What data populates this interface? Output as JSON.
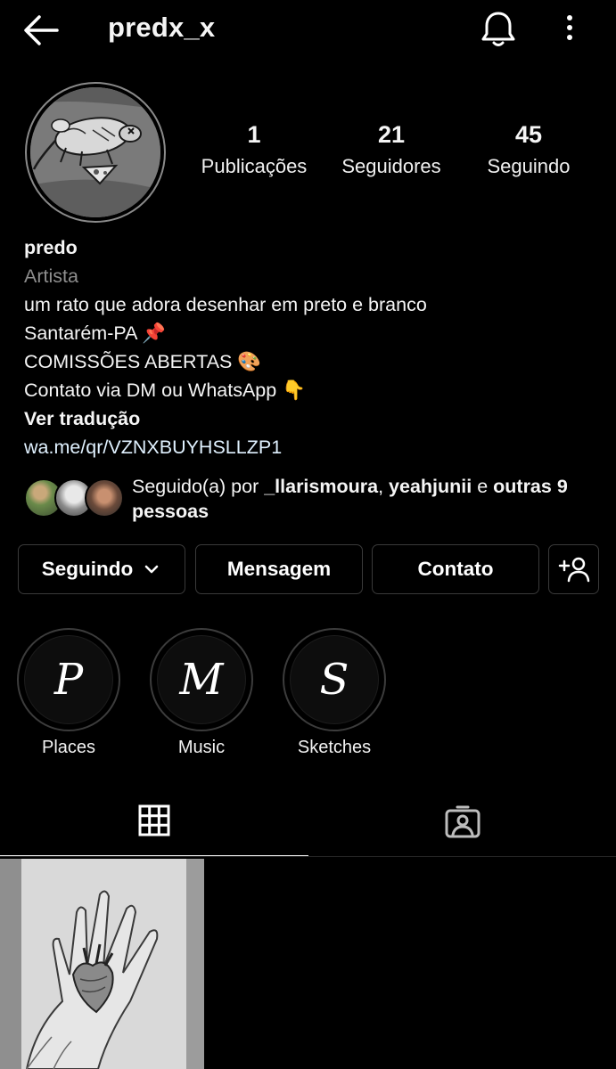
{
  "header": {
    "username": "predx_x",
    "back_icon": "arrow-left-icon",
    "notifications_icon": "bell-icon",
    "more_icon": "more-vertical-icon"
  },
  "profile": {
    "avatar_icon": "rat-drawing-avatar",
    "stats": [
      {
        "value": "1",
        "label": "Publicações"
      },
      {
        "value": "21",
        "label": "Seguidores"
      },
      {
        "value": "45",
        "label": "Seguindo"
      }
    ]
  },
  "bio": {
    "name": "predo",
    "category": "Artista",
    "lines": [
      "um rato que adora desenhar em preto e branco",
      "Santarém-PA 📌",
      "COMISSÕES ABERTAS 🎨",
      "Contato via DM ou WhatsApp 👇"
    ],
    "translate_label": "Ver tradução",
    "link": "wa.me/qr/VZNXBUYHSLLZP1"
  },
  "followed_by": {
    "prefix": "Seguido(a) por ",
    "user1": "_llarismoura",
    "separator": ", ",
    "user2": "yeahjunii",
    "connector": " e ",
    "others": "outras 9 pessoas"
  },
  "actions": {
    "following_label": "Seguindo",
    "message_label": "Mensagem",
    "contact_label": "Contato",
    "add_user_icon": "add-user-icon",
    "chevron_icon": "chevron-down-icon"
  },
  "highlights": [
    {
      "letter": "P",
      "label": "Places"
    },
    {
      "letter": "M",
      "label": "Music"
    },
    {
      "letter": "S",
      "label": "Sketches"
    }
  ],
  "tabs": {
    "grid_icon": "grid-icon",
    "tagged_icon": "tagged-person-icon"
  },
  "colors": {
    "background": "#000000",
    "text": "#f5f5f5",
    "muted": "#8e8e8e",
    "link": "#e0f1ff",
    "border": "#3a3a3a"
  }
}
